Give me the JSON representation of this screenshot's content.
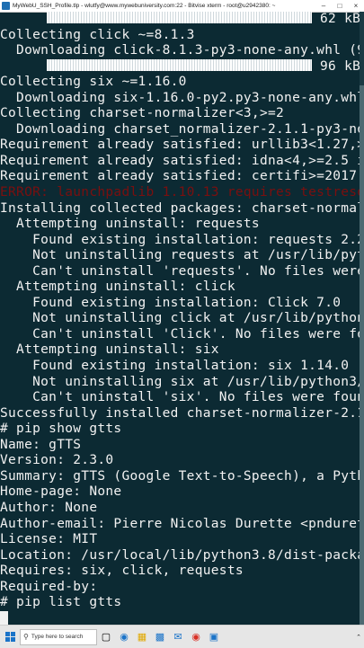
{
  "window": {
    "title": "MyWebU_SSH_Profile.tlp - wlutfy@www.mywebuniversity.com:22 - Bitvise xterm - root@u2942380: ~",
    "minimize_icon": "minimize-icon",
    "maximize_icon": "maximize-icon",
    "close_icon": "close-icon"
  },
  "terminal": {
    "progress_1": {
      "prefix": "",
      "suffix": " 62 kB"
    },
    "lines_a": [
      "Collecting click ~=8.1.3",
      "  Downloading click-8.1.3-py3-none-any.whl (9"
    ],
    "progress_2": {
      "prefix": "",
      "suffix": " 96 kB"
    },
    "lines_b": [
      "Collecting six ~=1.16.0",
      "  Downloading six-1.16.0-py2.py3-none-any.whl",
      "Collecting charset-normalizer<3,>=2",
      "  Downloading charset_normalizer-2.1.1-py3-no",
      "Requirement already satisfied: urllib3<1.27,>",
      "Requirement already satisfied: idna<4,>=2.5 i",
      "Requirement already satisfied: certifi>=2017."
    ],
    "error_line": "ERROR: launchpadlib 1.10.13 requires testreso",
    "lines_c": [
      "Installing collected packages: charset-normal",
      "  Attempting uninstall: requests",
      "    Found existing installation: requests 2.2",
      "    Not uninstalling requests at /usr/lib/pyt",
      "    Can't uninstall 'requests'. No files were",
      "  Attempting uninstall: click",
      "    Found existing installation: Click 7.0",
      "    Not uninstalling click at /usr/lib/python",
      "    Can't uninstall 'Click'. No files were fo",
      "  Attempting uninstall: six",
      "    Found existing installation: six 1.14.0",
      "    Not uninstalling six at /usr/lib/python3/",
      "    Can't uninstall 'six'. No files were foun",
      "Successfully installed charset-normalizer-2.1",
      "# pip show gtts",
      "Name: gTTS",
      "Version: 2.3.0",
      "Summary: gTTS (Google Text-to-Speech), a Pyth",
      "Home-page: None",
      "Author: None",
      "Author-email: Pierre Nicolas Durette <pnduret",
      "License: MIT",
      "Location: /usr/local/lib/python3.8/dist-packa",
      "Requires: six, click, requests",
      "Required-by:",
      "# pip list gtts"
    ],
    "prompt_line": ""
  },
  "taskbar": {
    "search_placeholder": "Type here to search",
    "icons": [
      "task-view-icon",
      "edge-icon",
      "file-explorer-icon",
      "store-icon",
      "mail-icon",
      "chrome-icon",
      "terminal-icon"
    ],
    "colors": {
      "accent": "#1a73c8",
      "terminal_bg": "#0c2a33",
      "error": "#7a0f0f"
    }
  }
}
